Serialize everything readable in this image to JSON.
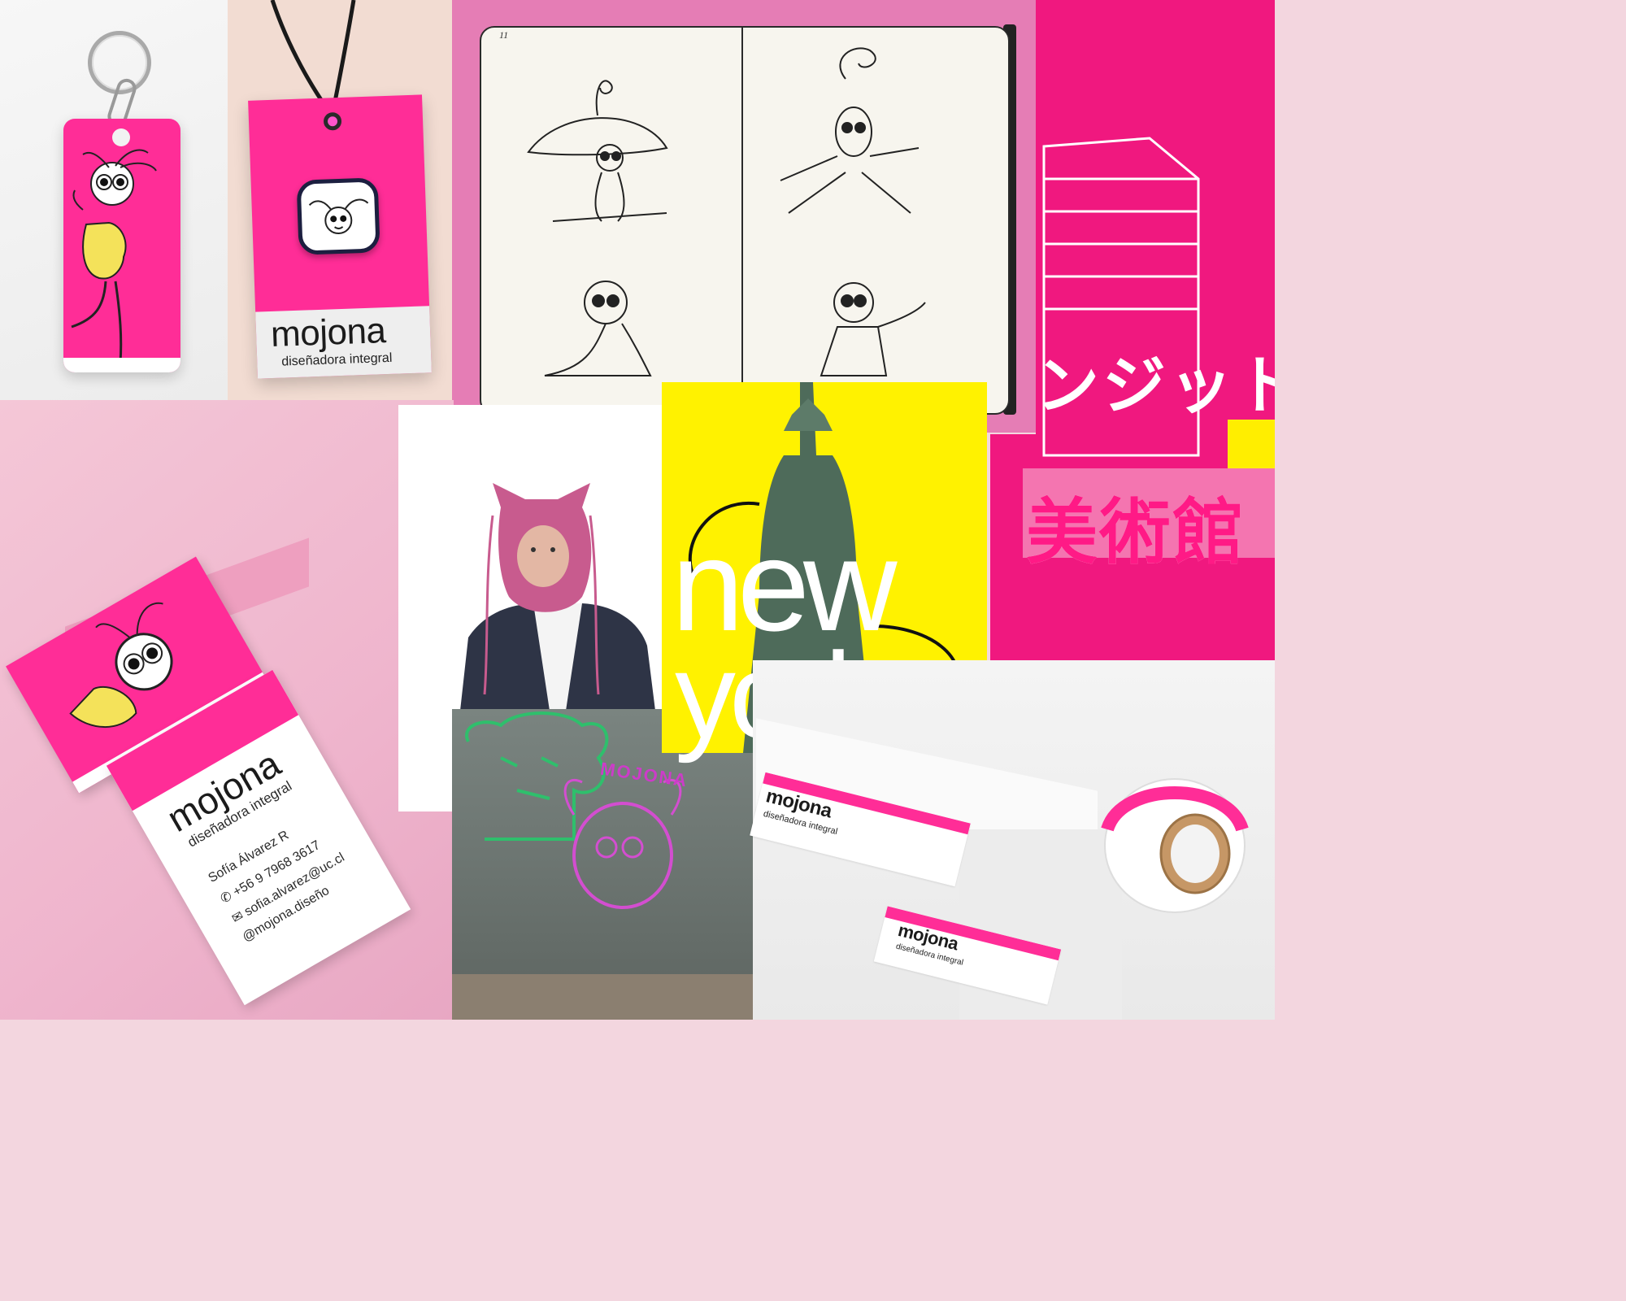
{
  "brand": {
    "name": "mojona",
    "tagline": "diseñadora integral"
  },
  "business_card": {
    "name_line": "Sofía Álvarez R",
    "phone": "+56 9 7968 3617",
    "email": "sofia.alvarez@uc.cl",
    "social": "@mojona.diseño"
  },
  "notebook": {
    "page_number": "11"
  },
  "poster_newyork": {
    "word1": "new",
    "word2": "york."
  },
  "poster_japan": {
    "katakana": "ンジットカ",
    "kanji": "美術館"
  },
  "wall": {
    "tag": "MOJONA"
  },
  "colors": {
    "brand_pink": "#ff2d97",
    "japan_pink": "#f0187f",
    "notebook_pink": "#e57db5",
    "ny_yellow": "#fff200",
    "jacket_yellow": "#f4e25a",
    "balaclava_pink": "#c85b8e"
  },
  "icons": {
    "lens": "lens-search-icon",
    "phone": "phone-icon",
    "email": "envelope-icon"
  }
}
